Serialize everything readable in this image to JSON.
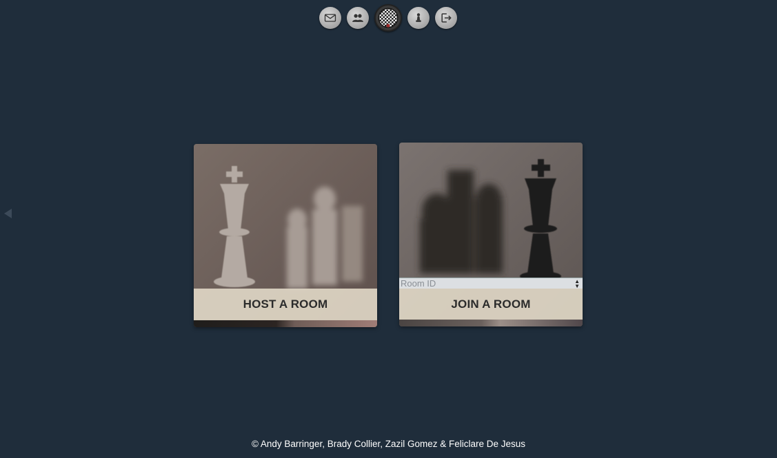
{
  "topnav": {
    "items": [
      {
        "icon": "mail-icon"
      },
      {
        "icon": "users-icon"
      },
      {
        "icon": "chess-logo-icon"
      },
      {
        "icon": "pawn-icon"
      },
      {
        "icon": "logout-icon"
      }
    ]
  },
  "host": {
    "button_label": "HOST A ROOM"
  },
  "join": {
    "input_placeholder": "Room ID",
    "input_value": "",
    "button_label": "JOIN A ROOM"
  },
  "footer": {
    "credits": "© Andy Barringer, Brady Collier, Zazil Gomez & Feliclare De Jesus"
  },
  "colors": {
    "background": "#1f2d3b",
    "button_bg": "#ded6c4",
    "button_text": "#2b2b2b",
    "footer_text": "#ffffff"
  }
}
